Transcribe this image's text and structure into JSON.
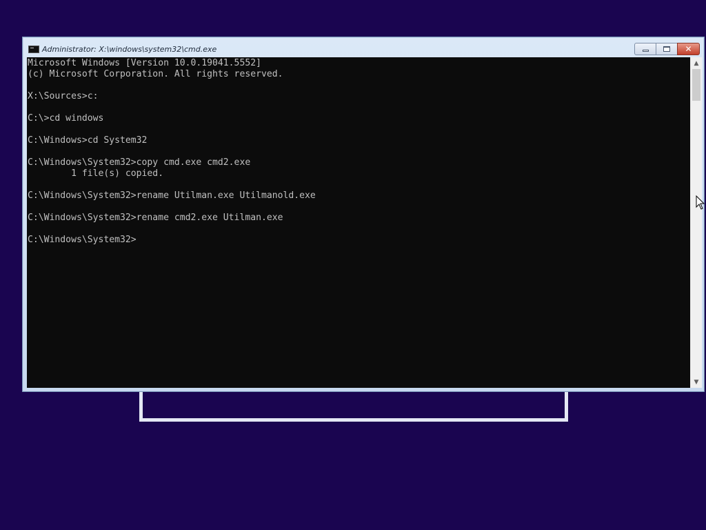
{
  "window": {
    "title": "Administrator: X:\\windows\\system32\\cmd.exe",
    "icon": "console-icon",
    "buttons": {
      "minimize": "minimize-icon",
      "maximize": "maximize-icon",
      "close_glyph": "✕"
    }
  },
  "console": {
    "lines": [
      "Microsoft Windows [Version 10.0.19041.5552]",
      "(c) Microsoft Corporation. All rights reserved.",
      "",
      "X:\\Sources>c:",
      "",
      "C:\\>cd windows",
      "",
      "C:\\Windows>cd System32",
      "",
      "C:\\Windows\\System32>copy cmd.exe cmd2.exe",
      "        1 file(s) copied.",
      "",
      "C:\\Windows\\System32>rename Utilman.exe Utilmanold.exe",
      "",
      "C:\\Windows\\System32>rename cmd2.exe Utilman.exe",
      "",
      "C:\\Windows\\System32>"
    ],
    "background": "#0c0c0c",
    "foreground": "#c0c0c0"
  },
  "scrollbar": {
    "up_glyph": "▲",
    "down_glyph": "▼"
  },
  "desktop": {
    "background": "#1a0550"
  }
}
